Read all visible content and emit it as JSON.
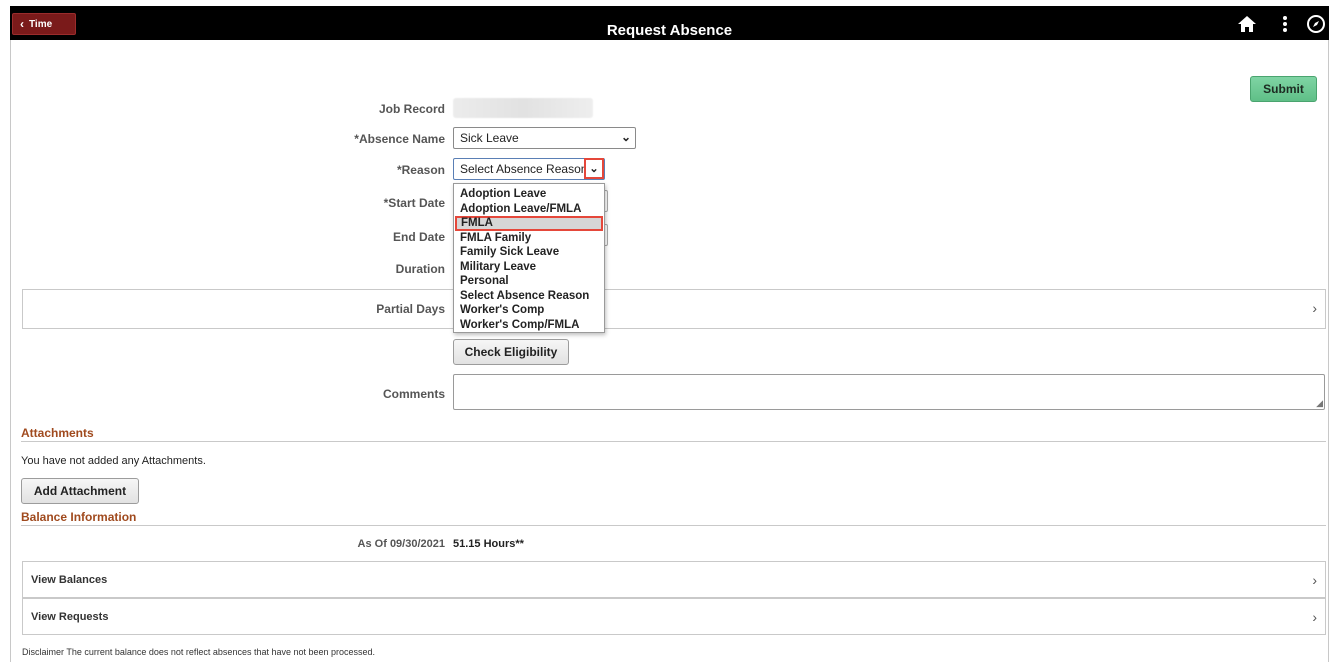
{
  "header": {
    "back_label": "Time",
    "title": "Request Absence"
  },
  "toolbar": {
    "submit_label": "Submit"
  },
  "form": {
    "job_record_label": "Job Record",
    "absence_name_label": "*Absence Name",
    "absence_name_value": "Sick Leave",
    "reason_label": "*Reason",
    "reason_value": "Select Absence Reason",
    "start_date_label": "*Start Date",
    "end_date_label": "End Date",
    "duration_label": "Duration",
    "partial_days_label": "Partial Days",
    "check_eligibility_label": "Check Eligibility",
    "comments_label": "Comments"
  },
  "reason_options": [
    "Adoption Leave",
    "Adoption Leave/FMLA",
    "FMLA",
    "FMLA Family",
    "Family Sick Leave",
    "Military Leave",
    "Personal",
    "Select Absence Reason",
    "Worker's Comp",
    "Worker's Comp/FMLA"
  ],
  "reason_highlighted": "FMLA",
  "attachments": {
    "title": "Attachments",
    "empty_text": "You have not added any Attachments.",
    "add_label": "Add Attachment"
  },
  "balance": {
    "title": "Balance Information",
    "as_of_label": "As Of 09/30/2021",
    "hours": "51.15 Hours**",
    "view_balances": "View Balances",
    "view_requests": "View Requests"
  },
  "disclaimer": "Disclaimer  The current balance does not reflect absences that have not been processed.",
  "colors": {
    "banner": "#000000",
    "back_button": "#7a1a1a",
    "submit_button": "#5fbf87",
    "section_title": "#a04a1e",
    "highlight_outline": "#e5473a"
  }
}
